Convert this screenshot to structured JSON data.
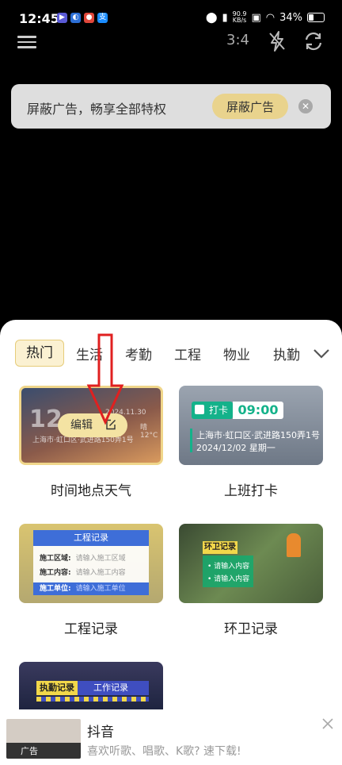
{
  "status_bar": {
    "time": "12:45",
    "net_speed_value": "90.9",
    "net_speed_unit": "KB/s",
    "battery": "34%"
  },
  "toolbar": {
    "aspect_ratio": "3:4"
  },
  "ad_bar": {
    "text": "屏蔽广告，畅享全部特权",
    "button": "屏蔽广告"
  },
  "tabs": [
    "热门",
    "生活",
    "考勤",
    "工程",
    "物业",
    "执勤"
  ],
  "cards": [
    {
      "title": "时间地点天气",
      "big_text": "12",
      "date": "2024.11.30",
      "temp": "晴 12°C",
      "location": "上海市·虹口区·武进路150弄1号",
      "edit_label": "编辑"
    },
    {
      "title": "上班打卡",
      "badge": "打卡",
      "time": "09:00",
      "address": "上海市·虹口区·武进路150弄1号",
      "date": "2024/12/02 星期一"
    },
    {
      "title": "工程记录",
      "header": "工程记录",
      "rows": [
        {
          "label": "施工区域:",
          "placeholder": "请输入施工区域"
        },
        {
          "label": "施工内容:",
          "placeholder": "请输入施工内容"
        }
      ],
      "footer_label": "施工单位:",
      "footer_placeholder": "请输入施工单位"
    },
    {
      "title": "环卫记录",
      "header": "环卫记录",
      "items": [
        "请输入内容",
        "请输入内容"
      ]
    },
    {
      "header": "执勤记录",
      "sub": "工作记录"
    }
  ],
  "bottom_ad": {
    "thumb_label": "广告",
    "app_name": "抖音",
    "slogan": "喜欢听歌、唱歌、K歌? 速下载!"
  },
  "colors": {
    "accent_gold": "#e9d38d",
    "green": "#14b28a",
    "blue": "#3e6ed8",
    "arrow_red": "#e02020"
  }
}
